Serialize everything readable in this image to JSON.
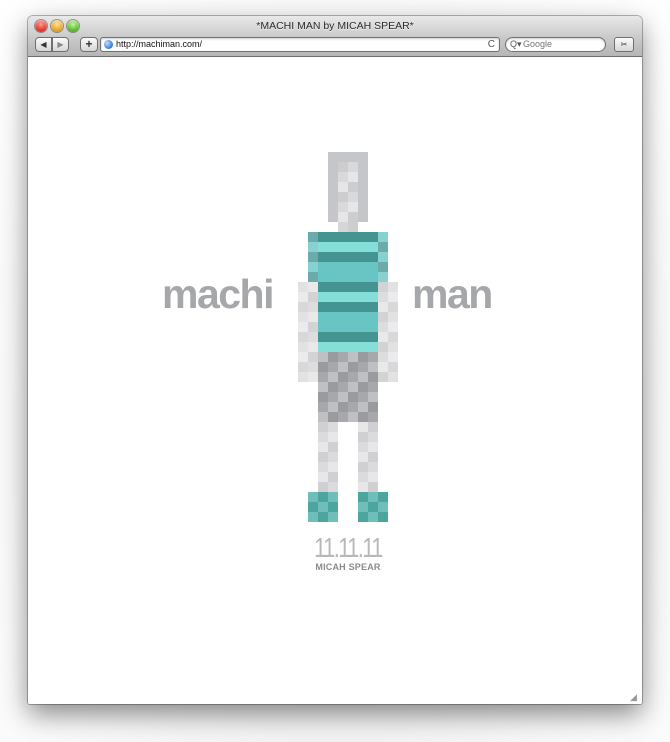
{
  "window": {
    "title": "*MACHI MAN by MICAH SPEAR*"
  },
  "toolbar": {
    "back_label": "◀",
    "forward_label": "▶",
    "add_label": "+",
    "url": "http://machiman.com/",
    "reload_label": "C",
    "search_placeholder": "Google",
    "search_icon": "Q▾",
    "snap_label": "✂"
  },
  "page": {
    "word_left": "machi",
    "word_right": "man",
    "date": "11.11.11",
    "author": "MICAH SPEAR"
  },
  "colors": {
    "word": "#a6a7aa",
    "shirt": "#5fc3c0",
    "shirt_light": "#7fdcd6",
    "shirt_dark": "#3a8f8c",
    "skin": "#d9dadc",
    "shorts": "#9c9ea2",
    "shoes": "#3a9b95"
  }
}
